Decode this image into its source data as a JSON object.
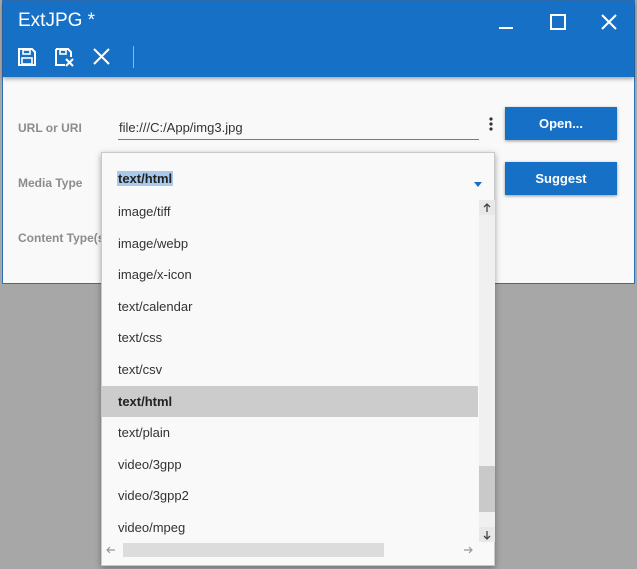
{
  "window": {
    "title": "ExtJPG *"
  },
  "toolbar": {
    "icons": [
      "save-icon",
      "save-close-icon",
      "close-icon"
    ]
  },
  "form": {
    "url_label": "URL or URI",
    "url_value": "file:///C:/App/img3.jpg",
    "media_type_label": "Media Type",
    "content_type_label": "Content Type(s",
    "open_button": "Open...",
    "suggest_button": "Suggest"
  },
  "dropdown": {
    "selected": "text/html",
    "items": [
      "image/tiff",
      "image/webp",
      "image/x-icon",
      "text/calendar",
      "text/css",
      "text/csv",
      "text/html",
      "text/plain",
      "video/3gpp",
      "video/3gpp2",
      "video/mpeg"
    ],
    "highlighted_index": 6
  },
  "colors": {
    "accent": "#1670c6",
    "highlight": "#cccccc"
  }
}
